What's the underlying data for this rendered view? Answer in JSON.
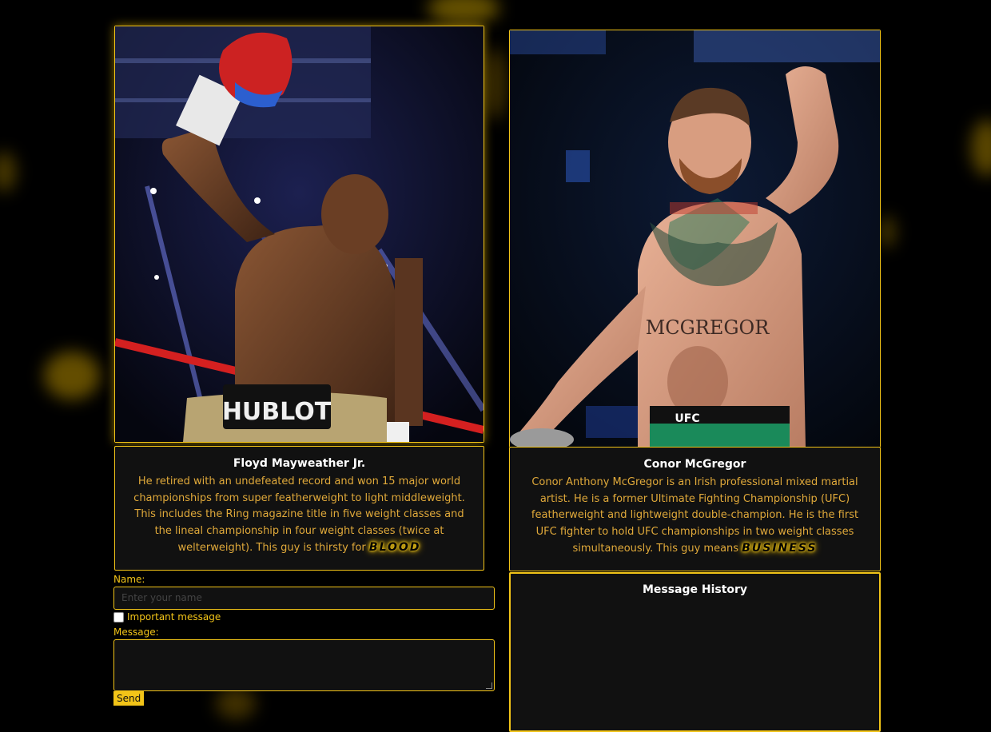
{
  "fighters": [
    {
      "name": "Floyd Mayweather Jr.",
      "bio": "He retired with an undefeated record and won 15 major world championships from super featherweight to light middleweight. This includes the Ring magazine title in five weight classes and the lineal championship in four weight classes (twice at welterweight). This guy is thirsty for",
      "emphasis": "BLOOD",
      "trunks_brand": "HUBLOT"
    },
    {
      "name": "Conor McGregor",
      "bio": "Conor Anthony McGregor is an Irish professional mixed martial artist. He is a former Ultimate Fighting Championship (UFC) featherweight and lightweight double-champion. He is the first UFC fighter to hold UFC championships in two weight classes simultaneously. This guy means",
      "emphasis": "BUSINESS",
      "tattoo_text": "MCGREGOR",
      "trunks_brand": "UFC"
    }
  ],
  "form": {
    "name_label": "Name:",
    "name_placeholder": "Enter your name",
    "important_label": "Important message",
    "message_label": "Message:",
    "send_label": "Send"
  },
  "history": {
    "title": "Message History"
  },
  "theme": {
    "accent": "#f2c418",
    "panel": "#111111"
  }
}
